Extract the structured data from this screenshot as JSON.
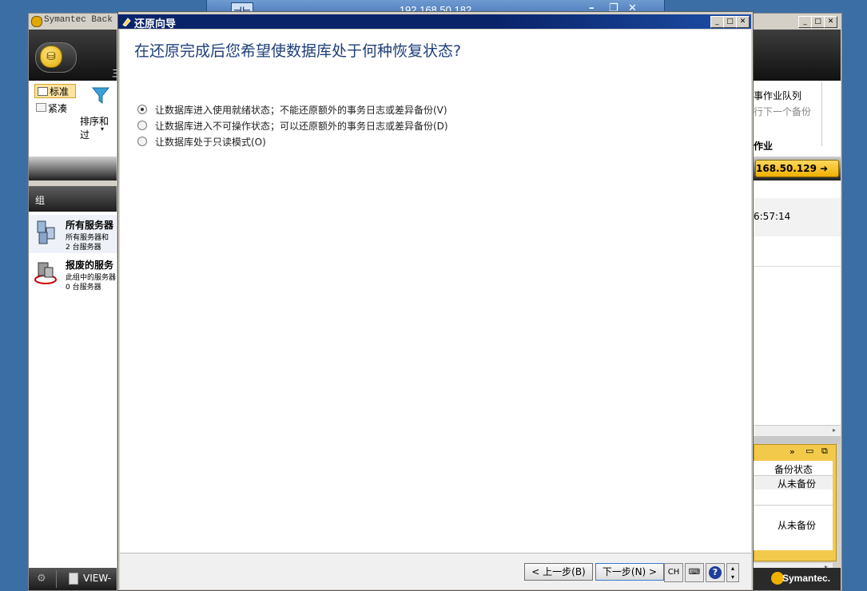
{
  "remote_bar": {
    "address": "192.168.50.182",
    "pin_icon": "pin-icon",
    "minimize": "–",
    "restore": "❐",
    "close": "✕"
  },
  "back_window": {
    "title": "Symantec Back",
    "ribbon_left": {
      "view_standard": "标准",
      "view_compact": "紧凑",
      "sort_filter": "排序和过",
      "partial_char": "三"
    },
    "ribbon_right": {
      "queue_title": "事作业队列",
      "run_next": "行下一个备份",
      "jobs": "作业",
      "server_badge": "168.50.129"
    },
    "groups_header": "组",
    "groups": [
      {
        "name": "所有服务器",
        "desc": "所有服务器和",
        "count": "2 台服务器"
      },
      {
        "name": "报废的服务",
        "desc": "此组中的服务器",
        "count": "0 台服务器"
      }
    ],
    "time_value": "6:57:14",
    "status_table": {
      "header": "备份状态",
      "rows": [
        "从未备份",
        "",
        "从未备份"
      ]
    },
    "taskbar_left": "VIEW-",
    "brand": "Symantec."
  },
  "dialog": {
    "title": "还原向导",
    "question": "在还原完成后您希望使数据库处于何种恢复状态?",
    "options": [
      {
        "label": "让数据库进入使用就绪状态；不能还原额外的事务日志或差异备份(V)",
        "selected": true
      },
      {
        "label": "让数据库进入不可操作状态；可以还原额外的事务日志或差异备份(D)",
        "selected": false
      },
      {
        "label": "让数据库处于只读模式(O)",
        "selected": false
      }
    ],
    "back_button": "< 上一步(B)",
    "next_button": "下一步(N) >",
    "tray_lang": "CH"
  }
}
